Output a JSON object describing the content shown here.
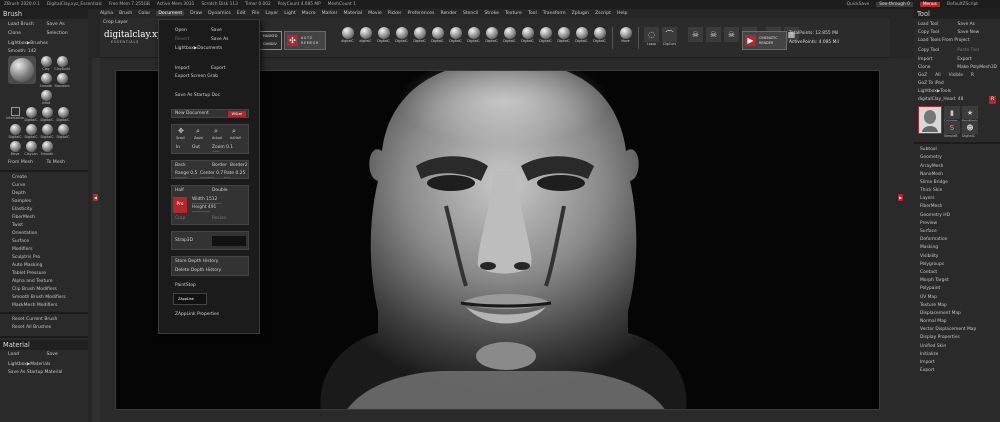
{
  "titlebar": {
    "app": "ZBrush 2020.0.1",
    "file": "DigitalClay.xyz_Essentials",
    "freemem": "Free Mem 7.255GB",
    "activemem": "Active Mem 3031",
    "scratch": "Scratch Disk 113",
    "timer": "Timer 0.002",
    "polycount": "PolyCount 4.085 MP",
    "meshcount": "MeshCount 1",
    "quicksave": "QuickSave",
    "seethrough": "See-through 0",
    "menus_btn": "Menus",
    "defaultzscript": "DefaultZScript"
  },
  "menubar": [
    "Alpha",
    "Brush",
    "Color",
    "Document",
    "Draw",
    "Dynamics",
    "Edit",
    "File",
    "Layer",
    "Light",
    "Macro",
    "Marker",
    "Material",
    "Movie",
    "Picker",
    "Preferences",
    "Render",
    "Stencil",
    "Stroke",
    "Texture",
    "Tool",
    "Transform",
    "Zplugin",
    "Zscript",
    "Help"
  ],
  "menubar_active": "Document",
  "brush_panel": {
    "title": "Brush",
    "buttons": [
      "Load Brush",
      "Save As",
      "Clone",
      "Selection"
    ],
    "lightbox": "Lightbox▶Brushes",
    "smooth": "Smooth: 142",
    "top_brushes": [
      "Clay",
      "ClayBuild",
      "Smooth",
      "Standard",
      "Inflat"
    ],
    "brushes": [
      "Intersectio",
      "DigitalC",
      "DigitalC",
      "DigitalC",
      "DigitalC",
      "DigitalC",
      "DigitalC",
      "DigitalC",
      "Move",
      "ClayLan",
      "Smooth"
    ],
    "from_mesh": "From Mesh",
    "to_mesh": "To Mesh",
    "subpalettes": [
      "Create",
      "Curve",
      "Depth",
      "Samples",
      "Elasticity",
      "FiberMesh",
      "Twist",
      "Orientation",
      "Surface",
      "Modifiers",
      "Sculptris Pro",
      "Auto Masking",
      "Tablet Pressure",
      "Alpha and Texture",
      "Clip Brush Modifiers",
      "Smooth Brush Modifiers",
      "MaskMesh Modifiers"
    ],
    "reset_current": "Reset Current Brush",
    "reset_all": "Reset All Brushes"
  },
  "material_panel": {
    "title": "Material",
    "buttons": [
      "Load",
      "Save"
    ],
    "lightbox": "Lightbox▶Materials",
    "startup": "Save As Startup Material"
  },
  "shelf": {
    "crop_layer": "Crop Layer",
    "logo": "digitalclay.xyz",
    "logo_sub": "ESSENTIALS",
    "masked_line1": "MASKED",
    "masked_line2": "DUBDIV",
    "autoremesh_line1": "AUTO",
    "autoremesh_line2": "REMESH",
    "brushes": [
      "digitalC",
      "digitalC",
      "DigitalC",
      "DigitalC",
      "DigitalC",
      "DigitalC",
      "DigitalC",
      "DigitalC",
      "DigitalC",
      "DigitalC",
      "DigitalC",
      "DigitalC",
      "DigitalC",
      "DigitalC",
      "DigitalC",
      "Move",
      "Lasso",
      "ClipCurv"
    ],
    "cinematic_line1": "CINEMATIC",
    "cinematic_line2": "RENDER",
    "total_points": "TotalPoints: 12.855 Mil",
    "active_points": "ActivePoints: 4.085 Mil"
  },
  "document_menu": {
    "open": "Open",
    "save": "Save",
    "revert": "Revert",
    "save_as": "Save As",
    "lightbox": "Lightbox▶Documents",
    "import": "Import",
    "export": "Export",
    "export_screen_grab": "Export Screen Grab",
    "save_startup": "Save As Startup Doc",
    "new_document": "New Document",
    "wsize": "WSize",
    "scroll": "Scroll",
    "zoom": "Zoom",
    "actual": "Actual",
    "aahalf": "AAHalf",
    "in": "In",
    "out": "Out",
    "zoom_value": "Zoom 0.1",
    "back": "Back",
    "border": "Border",
    "border2": "Border2",
    "range": "Range 0.5",
    "center": "Center 0.7",
    "rate": "Rate 0.25",
    "half": "Half",
    "double": "Double",
    "pro": "Pro",
    "width": "Width 1512",
    "height": "Height 491",
    "crop": "Crop",
    "resize": "Resize",
    "store_depth": "Store Depth History",
    "delete_depth": "Delete Depth History",
    "paintstop": "PaintStop",
    "zapplink_btn": "ZAppLink",
    "zapplink_props": "ZAppLink Properties",
    "strap3d": "Strap3D"
  },
  "tool_panel": {
    "title": "Tool",
    "buttons": [
      "Load Tool",
      "Save As",
      "Copy Tool",
      "Save New"
    ],
    "load_from_project": "Load Tools From Project",
    "buttons2": [
      "Copy Tool",
      "Paste Tool",
      "Import",
      "Export",
      "Clone",
      "Make PolyMesh3D",
      "GoZ",
      "All",
      "Visible",
      "R"
    ],
    "goz_ipad": "GoZ To iPad",
    "lightbox": "Lightbox▶Tools",
    "current_tool": "digitalClay_Head: 48",
    "r_label": "R",
    "thumbs": [
      "Cylinder",
      "PolyMesh",
      "SimpleB",
      "DigitalC"
    ],
    "subpalettes": [
      "Subtool",
      "Geometry",
      "ArrayMesh",
      "NanoMesh",
      "Slime Bridge",
      "Thick Skin",
      "Layers",
      "FiberMesh",
      "Geometry HD",
      "Preview",
      "Surface",
      "Deformation",
      "Masking",
      "Visibility",
      "Polygroups",
      "Contact",
      "Morph Target",
      "Polypaint",
      "UV Map",
      "Texture Map",
      "Displacement Map",
      "Normal Map",
      "Vector Displacement Map",
      "Display Properties",
      "Unified Skin",
      "Initialize",
      "Import",
      "Export"
    ]
  },
  "colors": {
    "accent": "#b3262b",
    "panel": "#2a2a2a",
    "canvas": "#050505"
  }
}
